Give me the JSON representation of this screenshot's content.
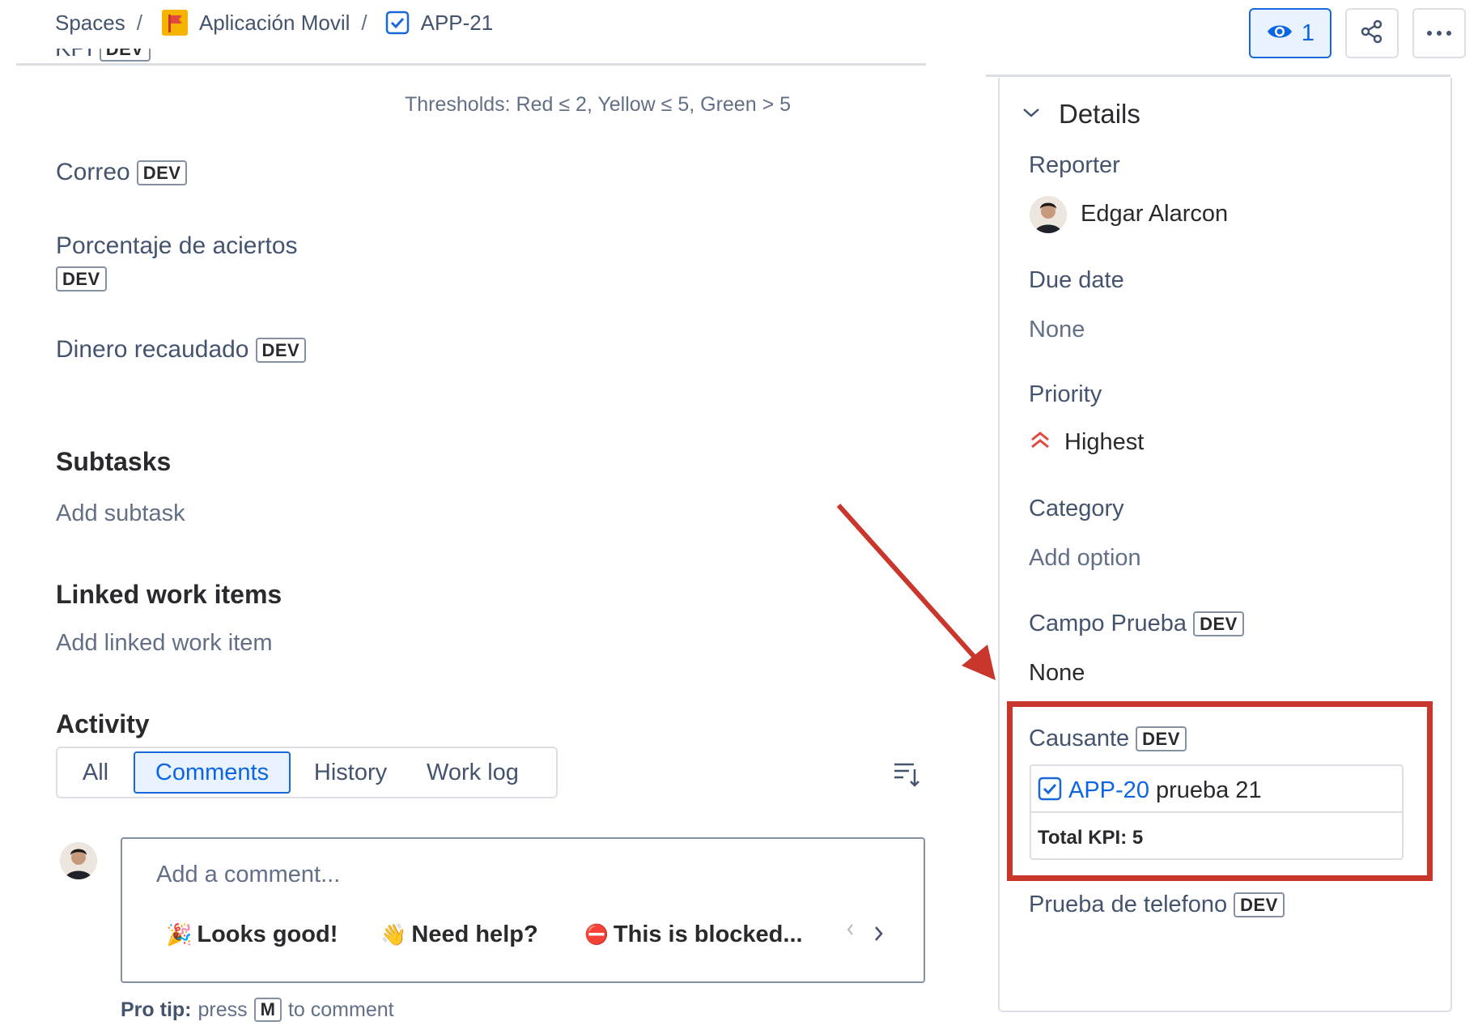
{
  "breadcrumb": {
    "spaces": "Spaces",
    "sep": "/",
    "project": "Aplicación Movil",
    "issue": "APP-21"
  },
  "header": {
    "watch_count": "1",
    "icons": [
      "eye-icon",
      "share-icon",
      "more-icon"
    ]
  },
  "badge": "DEV",
  "main": {
    "clipped_field": "KPI",
    "thresholds": "Thresholds: Red ≤ 2, Yellow ≤ 5, Green > 5",
    "fields": [
      {
        "label": "Correo"
      },
      {
        "label": "Porcentaje de aciertos"
      },
      {
        "label": "Dinero recaudado"
      }
    ],
    "subtasks": {
      "title": "Subtasks",
      "action": "Add subtask"
    },
    "linked": {
      "title": "Linked work items",
      "action": "Add linked work item"
    },
    "activity": {
      "title": "Activity",
      "tabs": [
        "All",
        "Comments",
        "History",
        "Work log"
      ],
      "active_tab": "Comments"
    },
    "comment": {
      "placeholder": "Add a comment...",
      "chips": [
        {
          "emoji": "🎉",
          "label": "Looks good!"
        },
        {
          "emoji": "👋",
          "label": "Need help?"
        },
        {
          "emoji": "⛔",
          "label": "This is blocked..."
        }
      ]
    },
    "pro_tip": {
      "prefix": "Pro tip:",
      "press": "press",
      "key": "M",
      "suffix": "to comment"
    }
  },
  "details": {
    "title": "Details",
    "reporter": {
      "label": "Reporter",
      "name": "Edgar Alarcon"
    },
    "due_date": {
      "label": "Due date",
      "value": "None"
    },
    "priority": {
      "label": "Priority",
      "value": "Highest"
    },
    "category": {
      "label": "Category",
      "value": "Add option"
    },
    "campo_prueba": {
      "label": "Campo Prueba",
      "value": "None"
    },
    "causante": {
      "label": "Causante",
      "link_key": "APP-20",
      "link_summary": "prueba 21",
      "total": "Total KPI: 5"
    },
    "prueba_telefono": {
      "label": "Prueba de telefono"
    }
  },
  "colors": {
    "accent": "#0c66e4",
    "highlight": "#c9372c",
    "priority": "#e2483d",
    "selected_bg": "#e9f2ff"
  }
}
